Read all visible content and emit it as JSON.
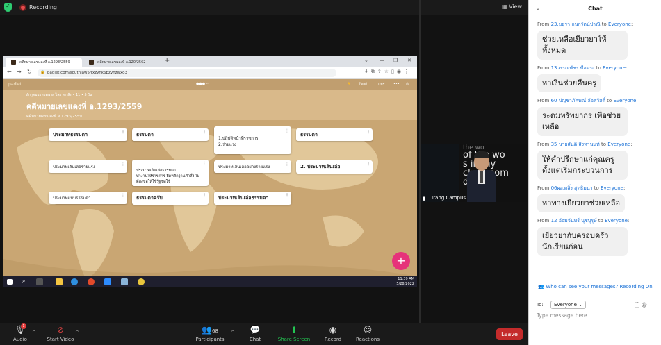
{
  "top_bar": {
    "recording_label": "Recording",
    "view_label": "View"
  },
  "browser": {
    "tabs": [
      {
        "label": "คดีหมายเลขแดงที่ อ.1293/2559",
        "active": true
      },
      {
        "label": "คดีหมายเลขแดงที่ อ.120/2562",
        "active": false
      }
    ],
    "url": "padlet.com/southlaw5/rxzynk6pzvhzwxo3"
  },
  "padlet": {
    "logo": "padlet",
    "author": "ผักกูดมวยทอดนาส ไลย ละ ล๊ะ  •  11  •  5 วัน",
    "title": "คดีหมายเลขแดงที่ อ.1293/2559",
    "subtitle": "คดีหมายเลขแดงที่ อ.1293/2559",
    "top_right": [
      "โพสต์",
      "แชร์",
      "•••"
    ],
    "cards": [
      {
        "text": "ประมาทธรรมดา",
        "bold": true
      },
      {
        "text": "ธรรมดา",
        "bold": true
      },
      {
        "text": "1.ปฏิบัติหน้าที่ราชการ\n2.ร่ายแรง",
        "bold": false
      },
      {
        "text": "ธรรมดา",
        "bold": true
      },
      {
        "text": "ประมาทเลินเล่อร้ายแรง",
        "bold": false
      },
      {
        "text": "ประมาทเลินเล่อธรรมดา\nทำงานให้ราชการ ยึดหลักฐานคำสั่ง ไม่\nต้องขอให้ใช้รัฐชดใช้",
        "bold": false
      },
      {
        "text": "ประมาทเลินเล่ออย่างร้ายแรง",
        "bold": false
      },
      {
        "text": "2. ประมาทเลินเล่อ",
        "bold": true
      },
      {
        "text": "ประมาทแบบธรรมดา",
        "bold": false
      },
      {
        "text": "ธรรมดาครับ",
        "bold": true
      },
      {
        "text": "ประมาทเลินเล่อธรรมดา",
        "bold": true
      }
    ]
  },
  "taskbar": {
    "time": "11:39 AM",
    "date": "5/28/2022"
  },
  "speaker": {
    "name": "Trang Campus",
    "backdrop_text": [
      "the wo",
      "of the wo",
      "s in my",
      "classroom",
      "day"
    ]
  },
  "chat": {
    "title": "Chat",
    "messages": [
      {
        "from": "23.มยุรา  กนกรัตน์ปาณี",
        "to": "Everyone",
        "text": "ช่วยเหลือเยียวยาให้ทั้งหมด"
      },
      {
        "from": "13วรรณพัชร ซื่อตรง",
        "to": "Everyone",
        "text": "หาเงินช่วยคืนครู"
      },
      {
        "from": "60 ปัญชาภัคพณ์ ล้อสวัสดิ์",
        "to": "Everyone",
        "text": "ระดมทรัพยากร เพื่อช่วยเหลือ"
      },
      {
        "from": "35 นายสันติ สิงหานนท์",
        "to": "Everyone",
        "text": "ให้คำปรึกษาแก่คุณครูตั้งแต่เริ่มกระบวนการ"
      },
      {
        "from": "06ผอ.ผลิ้ง สุทธิมนา",
        "to": "Everyone",
        "text": "หาทางเยียวยาช่วยเหลือ"
      },
      {
        "from": "12 อ้อมจันทร์ นุชบุรุษ์",
        "to": "Everyone",
        "text": "เยียวยากับครอบครัวนักเรียนก่อน"
      }
    ],
    "privacy_text": "Who can see your messages? Recording On",
    "to_label": "To:",
    "to_value": "Everyone",
    "placeholder": "Type message here..."
  },
  "toolbar": {
    "audio": "Audio",
    "audio_badge": "1",
    "start_video": "Start Video",
    "participants": "Participants",
    "participants_count": "68",
    "chat": "Chat",
    "share_screen": "Share Screen",
    "record": "Record",
    "reactions": "Reactions",
    "leave": "Leave"
  },
  "colors": {
    "share_green": "#23c552",
    "leave_red": "#c42b2b",
    "chat_link_blue": "#1a71d6",
    "padlet_bg": "#c9a673",
    "fab_pink": "#e6327a"
  }
}
